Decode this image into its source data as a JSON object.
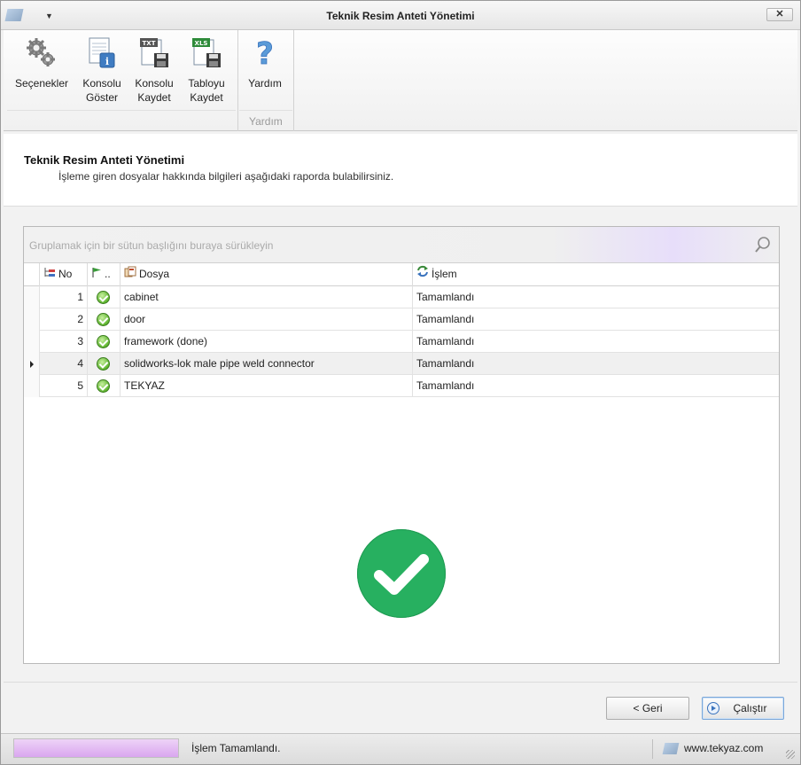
{
  "window": {
    "title": "Teknik Resim Anteti Yönetimi"
  },
  "ribbon": {
    "buttons": [
      {
        "label_line1": "Seçenekler",
        "label_line2": "",
        "icon": "gears-icon"
      },
      {
        "label_line1": "Konsolu",
        "label_line2": "Göster",
        "icon": "console-info-icon"
      },
      {
        "label_line1": "Konsolu",
        "label_line2": "Kaydet",
        "icon": "txt-save-icon",
        "badge": "TXT"
      },
      {
        "label_line1": "Tabloyu",
        "label_line2": "Kaydet",
        "icon": "xls-save-icon",
        "badge": "XLS"
      },
      {
        "label_line1": "Yardım",
        "label_line2": "",
        "icon": "help-icon"
      }
    ],
    "group_label": "Yardım"
  },
  "header": {
    "title": "Teknik Resim Anteti Yönetimi",
    "subtitle": "İşleme giren dosyalar hakkında bilgileri aşağıdaki raporda bulabilirsiniz."
  },
  "grid": {
    "group_hint": "Gruplamak için bir sütun başlığını buraya sürükleyin",
    "columns": {
      "no": "No",
      "status": "..",
      "file": "Dosya",
      "operation": "İşlem"
    },
    "rows": [
      {
        "no": "1",
        "file": "cabinet",
        "operation": "Tamamlandı",
        "status": "ok"
      },
      {
        "no": "2",
        "file": "door",
        "operation": "Tamamlandı",
        "status": "ok"
      },
      {
        "no": "3",
        "file": "framework (done)",
        "operation": "Tamamlandı",
        "status": "ok"
      },
      {
        "no": "4",
        "file": "solidworks-lok male pipe weld connector",
        "operation": "Tamamlandı",
        "status": "ok",
        "focused": true
      },
      {
        "no": "5",
        "file": "TEKYAZ",
        "operation": "Tamamlandı",
        "status": "ok"
      }
    ]
  },
  "footer": {
    "back_label": "< Geri",
    "run_label": "Çalıştır"
  },
  "status": {
    "text": "İşlem Tamamlandı.",
    "progress": 1.0,
    "brand": "www.tekyaz.com"
  },
  "colors": {
    "success": "#27b060",
    "progress": "#d9a6ef"
  }
}
